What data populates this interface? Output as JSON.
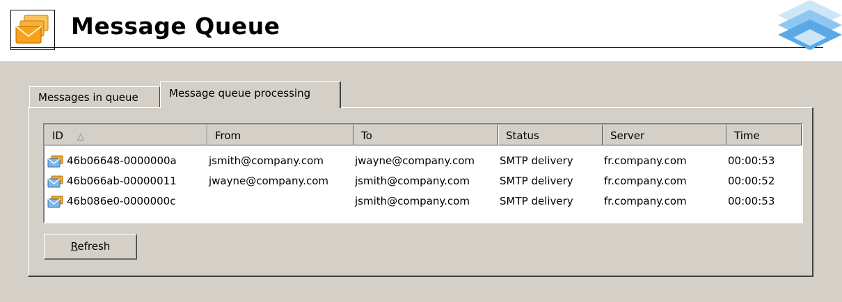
{
  "header": {
    "title": "Message Queue",
    "icon": "envelopes-icon",
    "logo": "brand-logo"
  },
  "tabs": [
    {
      "label": "Messages in queue",
      "active": false
    },
    {
      "label": "Message queue processing",
      "active": true
    }
  ],
  "table": {
    "columns": [
      "ID",
      "From",
      "To",
      "Status",
      "Server",
      "Time"
    ],
    "sort_column": "ID",
    "sort_indicator": "△",
    "rows": [
      {
        "id": "46b06648-0000000a",
        "from": "jsmith@company.com",
        "to": "jwayne@company.com",
        "status": "SMTP delivery",
        "server": "fr.company.com",
        "time": "00:00:53"
      },
      {
        "id": "46b066ab-00000011",
        "from": "jwayne@company.com",
        "to": "jsmith@company.com",
        "status": "SMTP delivery",
        "server": "fr.company.com",
        "time": "00:00:52"
      },
      {
        "id": "46b086e0-0000000c",
        "from": "",
        "to": "jsmith@company.com",
        "status": "SMTP delivery",
        "server": "fr.company.com",
        "time": "00:00:53"
      }
    ]
  },
  "buttons": {
    "refresh": "Refresh"
  },
  "colors": {
    "window_bg": "#d4d0c8",
    "icon_orange": "#f7a21b",
    "logo_blue": "#5aa9e6"
  }
}
